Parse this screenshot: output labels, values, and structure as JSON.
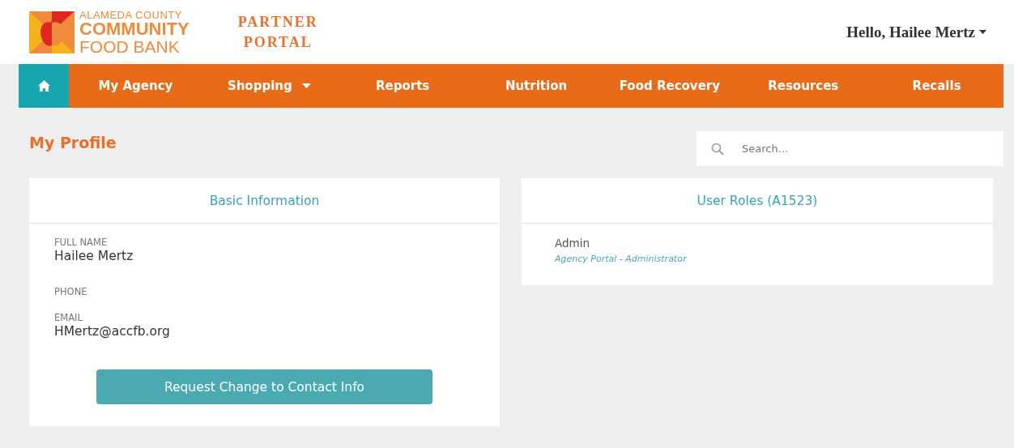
{
  "header": {
    "logo_lines": [
      "ALAMEDA COUNTY",
      "COMMUNITY",
      "FOOD BANK"
    ],
    "portal_lines": [
      "PARTNER",
      "PORTAL"
    ],
    "greeting": "Hello, Hailee Mertz"
  },
  "nav": [
    {
      "kind": "home",
      "selected": true
    },
    {
      "kind": "link",
      "label": "My Agency",
      "selected": false
    },
    {
      "kind": "dropdown",
      "label": "Shopping",
      "selected": false
    },
    {
      "kind": "link",
      "label": "Reports",
      "selected": false
    },
    {
      "kind": "link",
      "label": "Nutrition",
      "selected": false
    },
    {
      "kind": "link",
      "label": "Food Recovery",
      "selected": false
    },
    {
      "kind": "link",
      "label": "Resources",
      "selected": false
    },
    {
      "kind": "link",
      "label": "Recalls",
      "selected": false
    }
  ],
  "page_title": "My Profile",
  "search": {
    "placeholder": "Search..."
  },
  "basic_information": {
    "title": "Basic Information",
    "fields": [
      {
        "label": "FULL NAME",
        "value": "Hailee Mertz"
      },
      {
        "label": "PHONE"
      },
      {
        "label": "EMAIL",
        "value": "HMertz@accfb.org"
      }
    ],
    "button": "Request Change to Contact Info"
  },
  "user_roles": {
    "title": "User Roles (A1523)",
    "roles": [
      {
        "name": "Admin",
        "description": "Agency Portal - Administrator"
      }
    ]
  }
}
